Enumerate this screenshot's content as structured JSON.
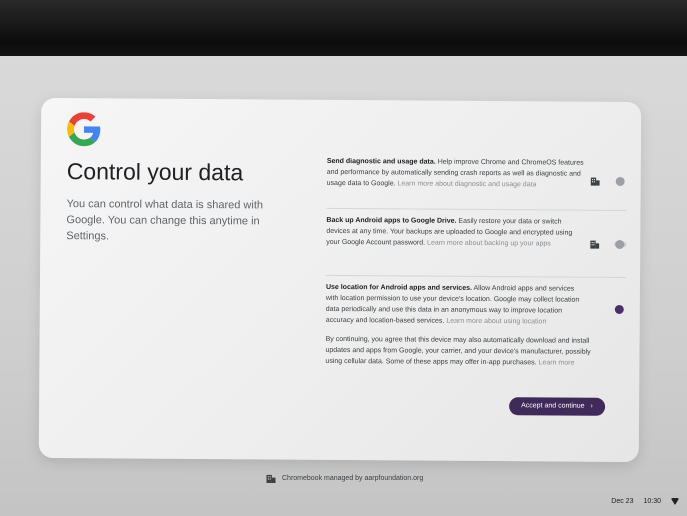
{
  "card": {
    "title": "Control your data",
    "subtitle": "You can control what data is shared with Google. You can change this anytime in Settings."
  },
  "options": [
    {
      "heading": "Send diagnostic and usage data.",
      "body": "Help improve Chrome and ChromeOS features and performance by automatically sending crash reports as well as diagnostic and usage data to Google.",
      "link": "Learn more about diagnostic and usage data",
      "enabled": false
    },
    {
      "heading": "Back up Android apps to Google Drive.",
      "body": "Easily restore your data or switch devices at any time. Your backups are uploaded to Google and encrypted using your Google Account password.",
      "link": "Learn more about backing up your apps",
      "enabled": false
    },
    {
      "heading": "Use location for Android apps and services.",
      "body": "Allow Android apps and services with location permission to use your device's location. Google may collect location data periodically and use this data in an anonymous way to improve location accuracy and location-based services.",
      "link": "Learn more about using location",
      "enabled": true
    }
  ],
  "consent": {
    "text": "By continuing, you agree that this device may also automatically download and install updates and apps from Google, your carrier, and your device's manufacturer, possibly using cellular data. Some of these apps may offer in-app purchases.",
    "link": "Learn more"
  },
  "button": {
    "label": "Accept and continue"
  },
  "footer": {
    "managed_text": "Chromebook managed by aarpfoundation.org"
  },
  "shelf": {
    "date": "Dec 23",
    "time": "10:30"
  },
  "colors": {
    "accent": "#3f2a5a",
    "toggle_on": "#4a2e68",
    "toggle_off": "#9aa0a6"
  }
}
